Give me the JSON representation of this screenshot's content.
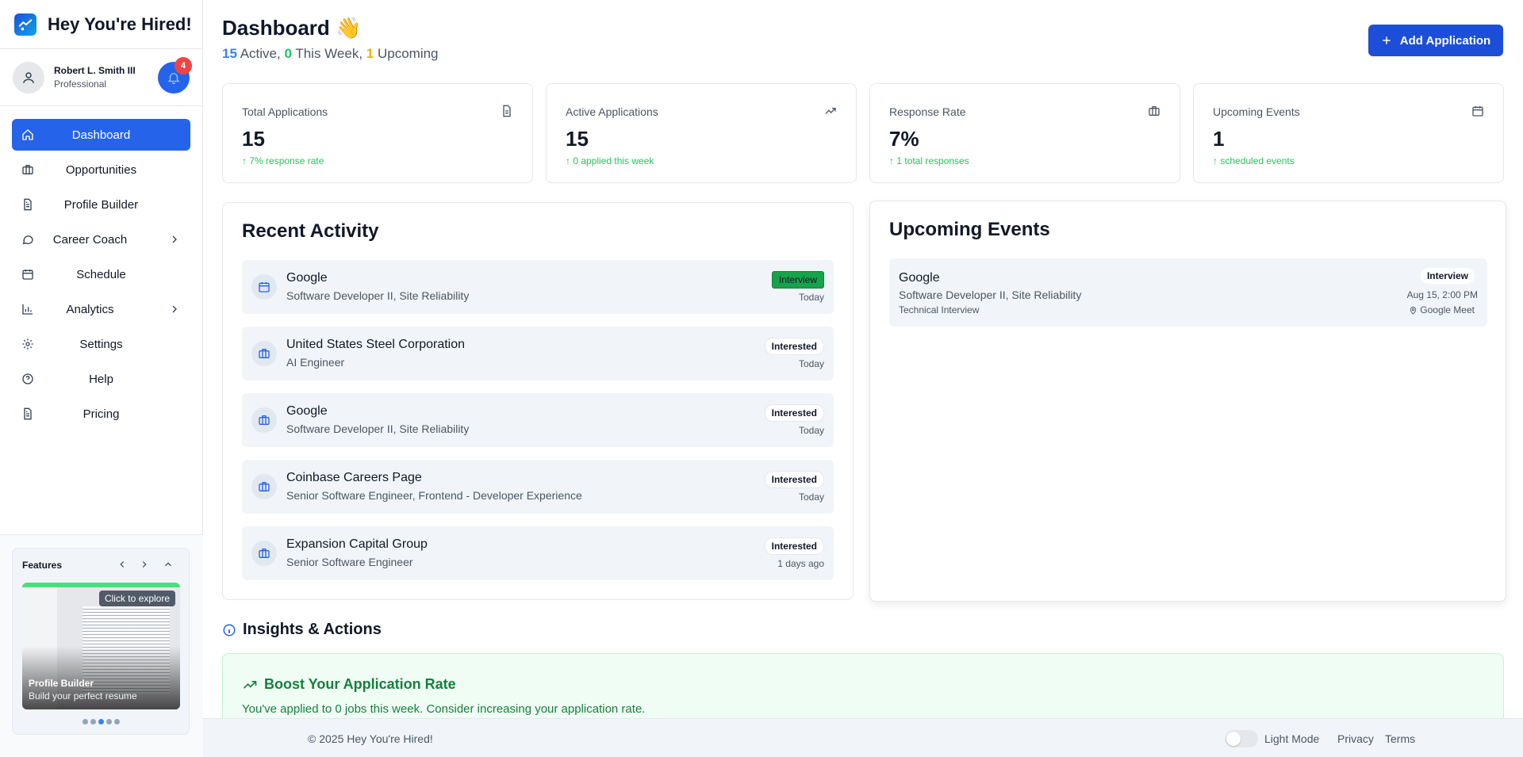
{
  "brand": {
    "title": "Hey You're Hired!"
  },
  "user": {
    "name": "Robert L. Smith III",
    "plan": "Professional",
    "notifications": "4"
  },
  "nav": {
    "items": [
      {
        "label": "Dashboard",
        "icon": "home-icon",
        "active": true
      },
      {
        "label": "Opportunities",
        "icon": "briefcase-icon"
      },
      {
        "label": "Profile Builder",
        "icon": "document-icon"
      },
      {
        "label": "Career Coach",
        "icon": "chat-icon",
        "has_submenu": true
      },
      {
        "label": "Schedule",
        "icon": "calendar-icon"
      },
      {
        "label": "Analytics",
        "icon": "bar-chart-icon",
        "has_submenu": true
      },
      {
        "label": "Settings",
        "icon": "gear-icon"
      },
      {
        "label": "Help",
        "icon": "help-icon"
      },
      {
        "label": "Pricing",
        "icon": "document-icon"
      }
    ]
  },
  "features": {
    "title": "Features",
    "explore": "Click to explore",
    "caption_title": "Profile Builder",
    "caption_sub": "Build your perfect resume",
    "slide_count": 5,
    "active_slide": 3
  },
  "header": {
    "title": "Dashboard 👋",
    "active_count": "15",
    "active_label": " Active, ",
    "week_count": "0",
    "week_label": " This Week, ",
    "upcoming_count": "1",
    "upcoming_label": " Upcoming",
    "add_button": "Add Application"
  },
  "stats": [
    {
      "label": "Total Applications",
      "value": "15",
      "trend": "7% response rate",
      "icon": "document-icon"
    },
    {
      "label": "Active Applications",
      "value": "15",
      "trend": "0 applied this week",
      "icon": "trending-up-icon"
    },
    {
      "label": "Response Rate",
      "value": "7%",
      "trend": "1 total responses",
      "icon": "briefcase-icon"
    },
    {
      "label": "Upcoming Events",
      "value": "1",
      "trend": "scheduled events",
      "icon": "calendar-icon"
    }
  ],
  "recent_activity": {
    "title": "Recent Activity",
    "items": [
      {
        "company": "Google",
        "role": "Software Developer II, Site Reliability",
        "status": "Interview",
        "time": "Today",
        "icon": "calendar-icon"
      },
      {
        "company": "United States Steel Corporation",
        "role": "AI Engineer",
        "status": "Interested",
        "time": "Today",
        "icon": "briefcase-icon"
      },
      {
        "company": "Google",
        "role": "Software Developer II, Site Reliability",
        "status": "Interested",
        "time": "Today",
        "icon": "briefcase-icon"
      },
      {
        "company": "Coinbase Careers Page",
        "role": "Senior Software Engineer, Frontend - Developer Experience",
        "status": "Interested",
        "time": "Today",
        "icon": "briefcase-icon"
      },
      {
        "company": "Expansion Capital Group",
        "role": "Senior Software Engineer",
        "status": "Interested",
        "time": "1 days ago",
        "icon": "briefcase-icon"
      }
    ]
  },
  "upcoming_events": {
    "title": "Upcoming Events",
    "items": [
      {
        "company": "Google",
        "role": "Software Developer II, Site Reliability",
        "type": "Technical Interview",
        "status": "Interview",
        "when": "Aug 15, 2:00 PM",
        "where": "Google Meet"
      }
    ]
  },
  "insights": {
    "title": "Insights & Actions",
    "boost_title": "Boost Your Application Rate",
    "boost_desc": "You've applied to 0 jobs this week. Consider increasing your application rate."
  },
  "footer": {
    "copyright": "© 2025 Hey You're Hired!",
    "mode_label": "Light Mode",
    "privacy": "Privacy",
    "terms": "Terms"
  },
  "colors": {
    "primary": "#2563eb",
    "success": "#22c55e",
    "warning": "#eab308",
    "danger": "#ef4444"
  }
}
